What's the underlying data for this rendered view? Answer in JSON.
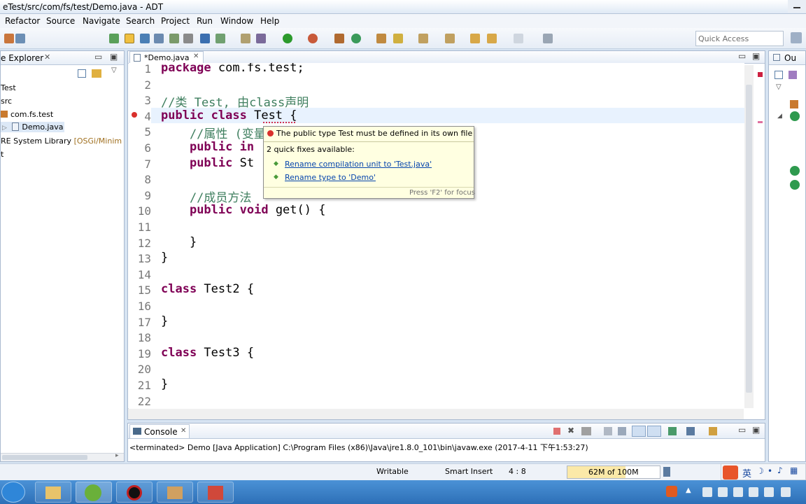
{
  "window": {
    "title": "eTest/src/com/fs/test/Demo.java - ADT"
  },
  "menu": [
    "Refactor",
    "Source",
    "Navigate",
    "Search",
    "Project",
    "Run",
    "Window",
    "Help"
  ],
  "quick_access": {
    "placeholder": "Quick Access"
  },
  "explorer": {
    "tab_label": "e Explorer",
    "tree": [
      {
        "label": "Test"
      },
      {
        "label": "src"
      },
      {
        "label": "com.fs.test"
      },
      {
        "label": "Demo.java"
      },
      {
        "label": "RE System Library",
        "suffix": "[OSGi/Minim"
      },
      {
        "label": "t"
      }
    ]
  },
  "editor": {
    "tab_label": "*Demo.java",
    "lines": [
      {
        "n": "1",
        "segs": [
          {
            "t": "package",
            "c": "kw"
          },
          {
            "t": " com.fs.test;",
            "c": ""
          }
        ]
      },
      {
        "n": "2",
        "segs": []
      },
      {
        "n": "3",
        "segs": [
          {
            "t": "//类 Test, 由class声明",
            "c": "cm"
          }
        ]
      },
      {
        "n": "4",
        "segs": [
          {
            "t": "public",
            "c": "kw"
          },
          {
            "t": " ",
            "c": ""
          },
          {
            "t": "class",
            "c": "kw"
          },
          {
            "t": " Test {",
            "c": ""
          }
        ]
      },
      {
        "n": "5",
        "segs": [
          {
            "t": "    //属性 (变量)",
            "c": "cm"
          }
        ]
      },
      {
        "n": "6",
        "segs": [
          {
            "t": "    ",
            "c": ""
          },
          {
            "t": "public",
            "c": "kw"
          },
          {
            "t": " in",
            "c": "kw"
          }
        ]
      },
      {
        "n": "7",
        "segs": [
          {
            "t": "    ",
            "c": ""
          },
          {
            "t": "public",
            "c": "kw"
          },
          {
            "t": " St",
            "c": ""
          }
        ]
      },
      {
        "n": "8",
        "segs": []
      },
      {
        "n": "9",
        "segs": [
          {
            "t": "    //成员方法",
            "c": "cm"
          }
        ]
      },
      {
        "n": "10",
        "segs": [
          {
            "t": "    ",
            "c": ""
          },
          {
            "t": "public",
            "c": "kw"
          },
          {
            "t": " ",
            "c": ""
          },
          {
            "t": "void",
            "c": "kw"
          },
          {
            "t": " get() {",
            "c": ""
          }
        ]
      },
      {
        "n": "11",
        "segs": []
      },
      {
        "n": "12",
        "segs": [
          {
            "t": "    }",
            "c": ""
          }
        ]
      },
      {
        "n": "13",
        "segs": [
          {
            "t": "}",
            "c": ""
          }
        ]
      },
      {
        "n": "14",
        "segs": []
      },
      {
        "n": "15",
        "segs": [
          {
            "t": "class",
            "c": "kw"
          },
          {
            "t": " Test2 {",
            "c": ""
          }
        ]
      },
      {
        "n": "16",
        "segs": []
      },
      {
        "n": "17",
        "segs": [
          {
            "t": "}",
            "c": ""
          }
        ]
      },
      {
        "n": "18",
        "segs": []
      },
      {
        "n": "19",
        "segs": [
          {
            "t": "class",
            "c": "kw"
          },
          {
            "t": " Test3 {",
            "c": ""
          }
        ]
      },
      {
        "n": "20",
        "segs": []
      },
      {
        "n": "21",
        "segs": [
          {
            "t": "}",
            "c": ""
          }
        ]
      },
      {
        "n": "22",
        "segs": []
      }
    ]
  },
  "popup": {
    "message": "The public type Test must be defined in its own file",
    "quick_fixes_header": "2 quick fixes available:",
    "fixes": [
      "Rename compilation unit to 'Test.java'",
      "Rename type to 'Demo'"
    ],
    "footer": "Press 'F2' for focus"
  },
  "console": {
    "tab_label": "Console",
    "text": "<terminated> Demo [Java Application] C:\\Program Files (x86)\\Java\\jre1.8.0_101\\bin\\javaw.exe (2017-4-11 下午1:53:27)"
  },
  "outline": {
    "tab_label": "Ou"
  },
  "status": {
    "writable": "Writable",
    "insert_mode": "Smart Insert",
    "position": "4 : 8",
    "memory": "62M of 100M"
  },
  "tray": {
    "ime_label": "英"
  },
  "colors": {
    "keyword": "#7f0055",
    "comment": "#3f7f5f",
    "link": "#0645ad",
    "popup_bg": "#ffffe1"
  }
}
